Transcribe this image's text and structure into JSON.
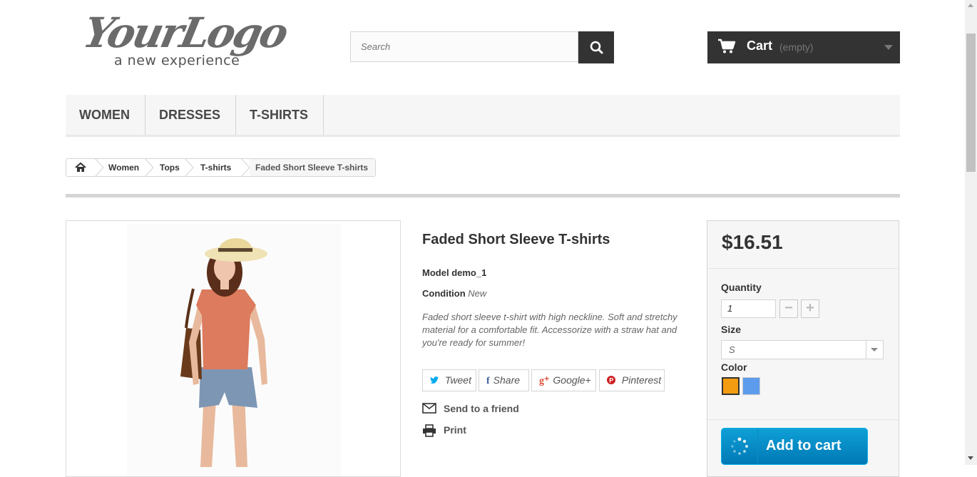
{
  "header": {
    "logo_main": "YourLogo",
    "logo_tagline": "a new experience",
    "search_placeholder": "Search",
    "cart_label": "Cart",
    "cart_status": "(empty)"
  },
  "menu": {
    "items": [
      "WOMEN",
      "DRESSES",
      "T-SHIRTS"
    ]
  },
  "breadcrumb": {
    "items": [
      "Women",
      "Tops",
      "T-shirts"
    ],
    "current": "Faded Short Sleeve T-shirts"
  },
  "product": {
    "title": "Faded Short Sleeve T-shirts",
    "model_label": "Model",
    "model_value": "demo_1",
    "condition_label": "Condition",
    "condition_value": "New",
    "description": "Faded short sleeve t-shirt with high neckline. Soft and stretchy material for a comfortable fit. Accessorize with a straw hat and you're ready for summer!",
    "social": [
      {
        "icon": "twitter-icon",
        "glyph": "❀",
        "label": "Tweet",
        "color": "#00aaf0"
      },
      {
        "icon": "facebook-icon",
        "glyph": "f",
        "label": "Share",
        "color": "#435f9f"
      },
      {
        "icon": "google-plus-icon",
        "glyph": "g⁺",
        "label": "Google+",
        "color": "#e04b34"
      },
      {
        "icon": "pinterest-icon",
        "glyph": "P",
        "label": "Pinterest",
        "color": "#ce1f21"
      }
    ],
    "send_to_friend": "Send to a friend",
    "print": "Print"
  },
  "buy_box": {
    "price": "$16.51",
    "quantity_label": "Quantity",
    "quantity_value": "1",
    "quantity_minus": "−",
    "quantity_plus": "+",
    "size_label": "Size",
    "size_value": "S",
    "color_label": "Color",
    "colors": [
      "#f39c11",
      "#5d9cec"
    ],
    "add_to_cart": "Add to cart"
  },
  "colors": {
    "dark": "#333333",
    "accent_blue": "#0f9fd6",
    "menu_bg": "#f6f6f6"
  }
}
